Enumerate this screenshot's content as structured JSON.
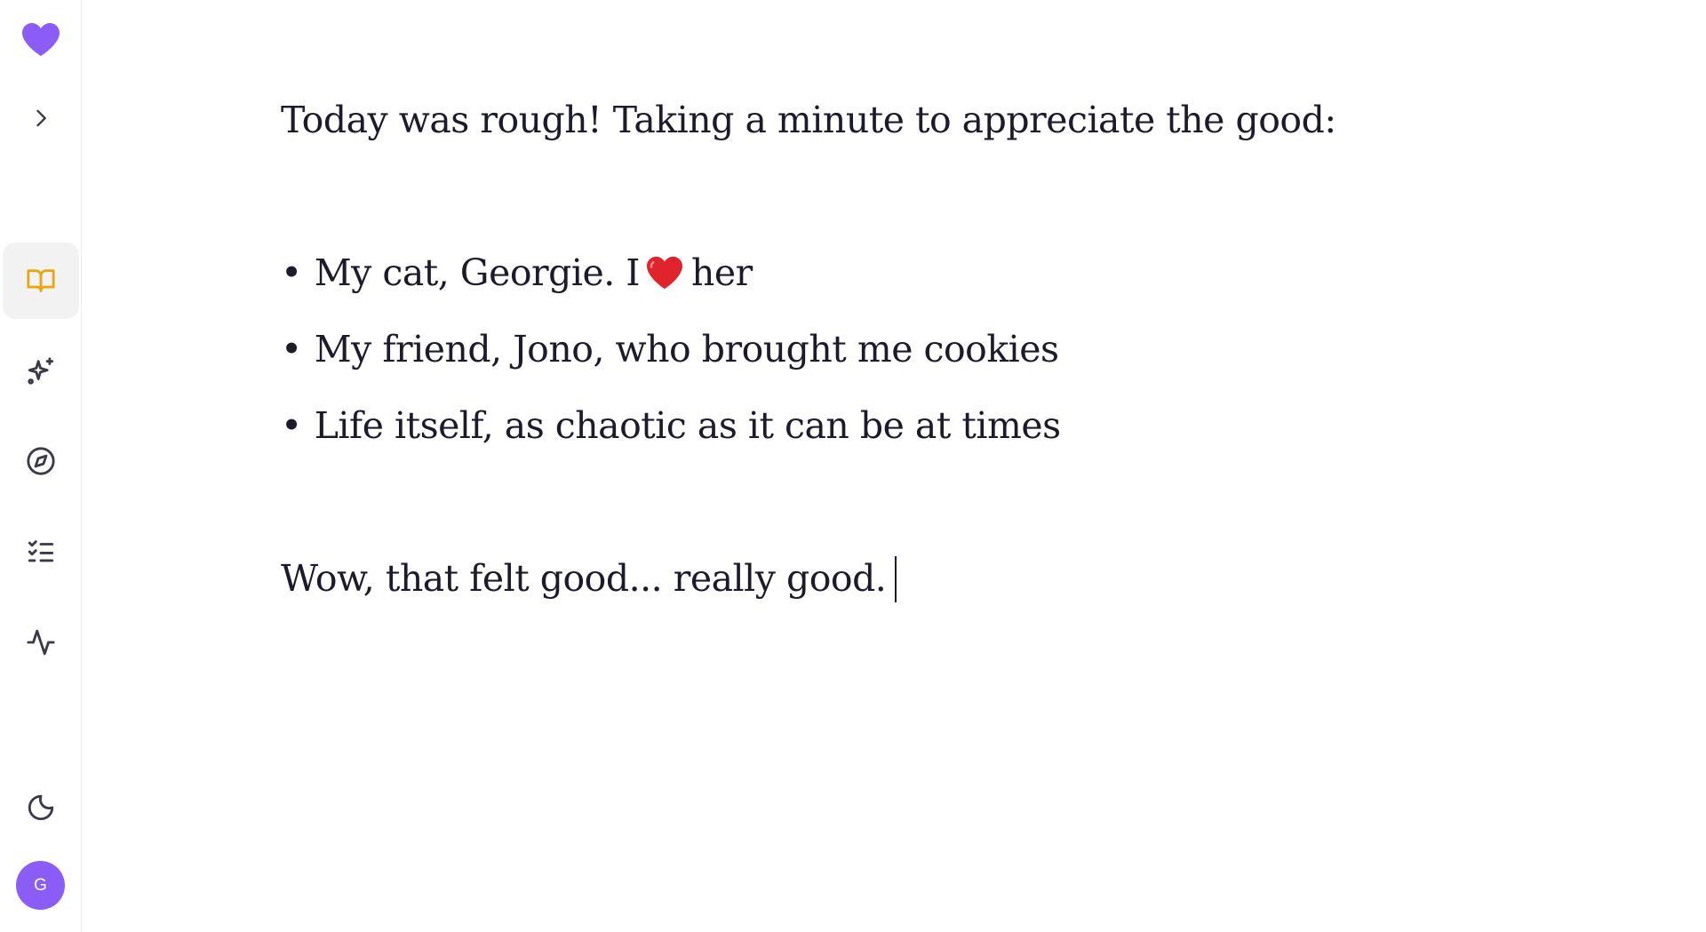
{
  "app": {
    "brand_color": "#8b5cf6",
    "active_color": "#e8a613"
  },
  "sidebar": {
    "logo_icon": "heart-icon",
    "items": [
      {
        "name": "expand",
        "icon": "chevron-right-icon",
        "active": false
      },
      {
        "name": "journal",
        "icon": "book-open-icon",
        "active": true
      },
      {
        "name": "prompts",
        "icon": "sparkles-icon",
        "active": false
      },
      {
        "name": "explore",
        "icon": "compass-icon",
        "active": false
      },
      {
        "name": "checklist",
        "icon": "list-checks-icon",
        "active": false
      },
      {
        "name": "insights",
        "icon": "activity-icon",
        "active": false
      },
      {
        "name": "theme",
        "icon": "moon-icon",
        "active": false
      }
    ],
    "avatar_initial": "G"
  },
  "entry": {
    "intro": "Today was rough! Taking a minute to appreciate the good:",
    "bullets": [
      {
        "before": "My cat, Georgie. I",
        "emoji": "red-heart-emoji",
        "after": "her"
      },
      {
        "text": "My friend, Jono, who brought me cookies"
      },
      {
        "text": "Life itself, as chaotic as it can be at times"
      }
    ],
    "bullet_symbol": "•",
    "closing": "Wow, that felt good... really good."
  }
}
